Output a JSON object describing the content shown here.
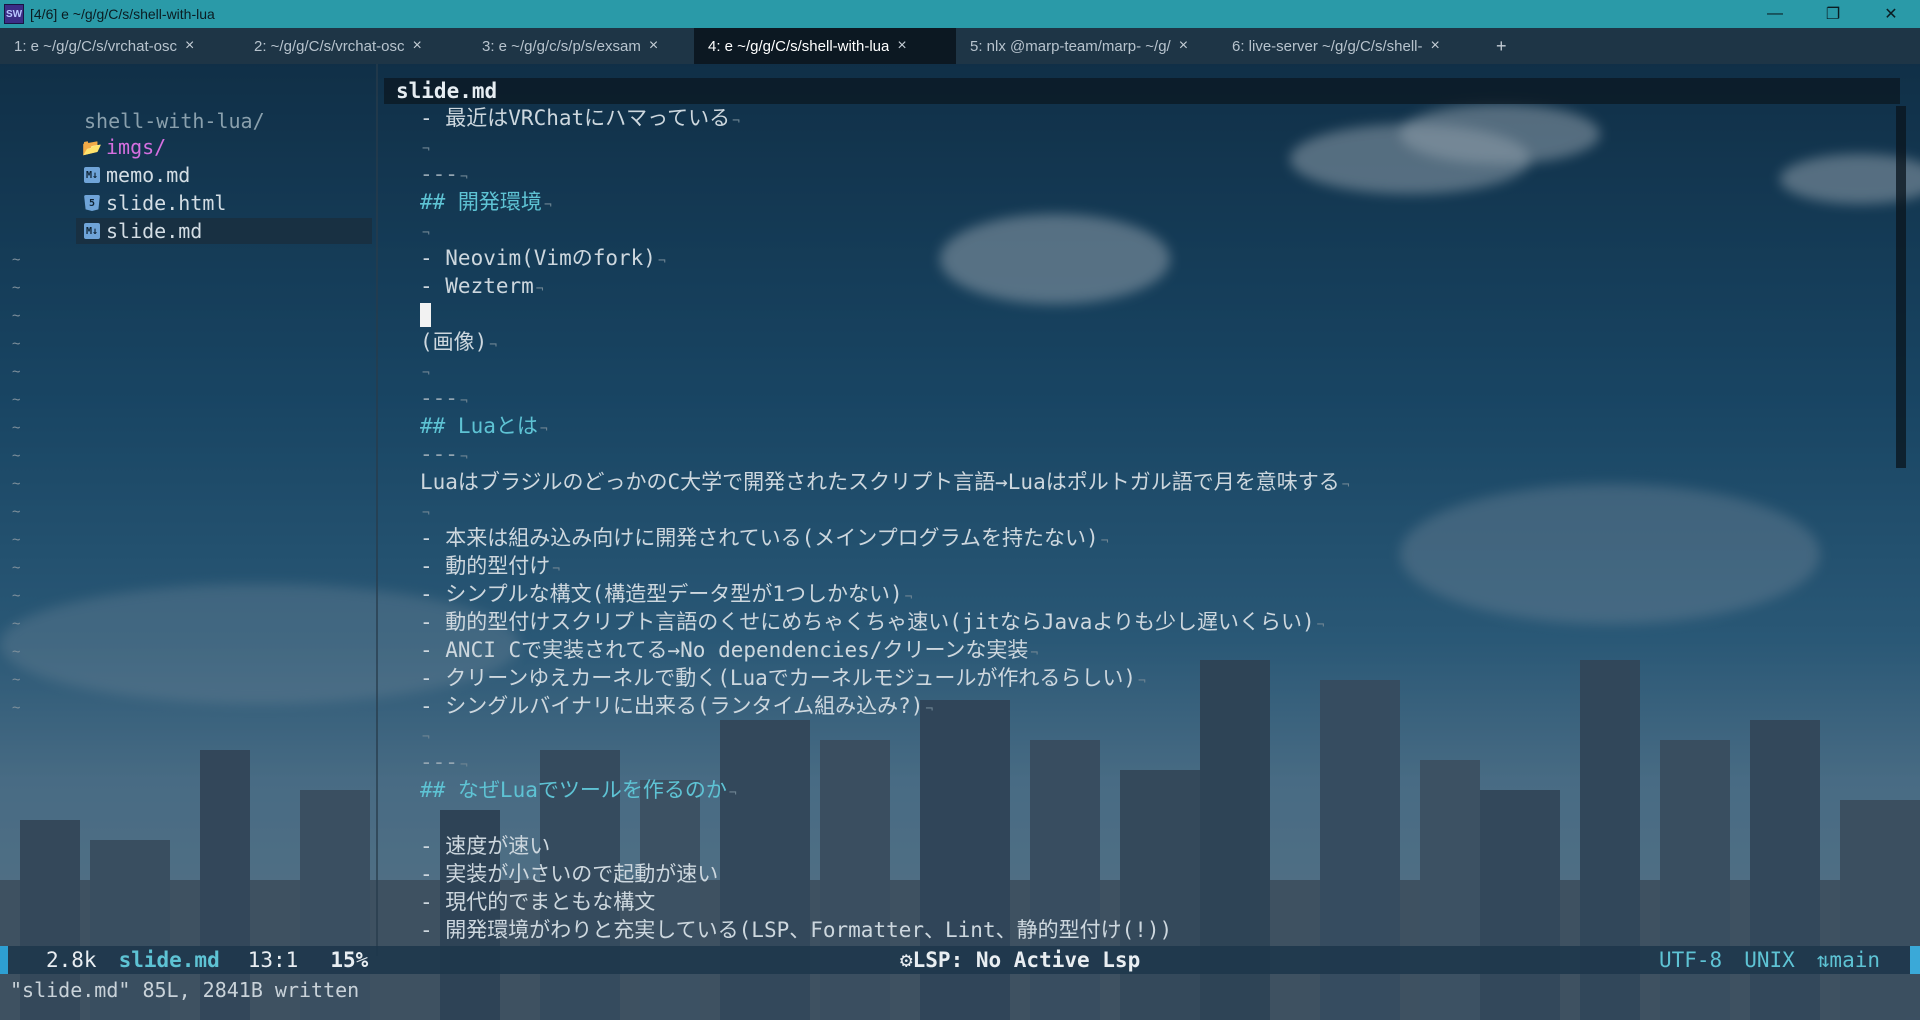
{
  "window": {
    "title": "[4/6] e ~/g/g/C/s/shell-with-lua",
    "app_icon": "SW",
    "minimize": "—",
    "restore": "❐",
    "close": "✕"
  },
  "tabs": [
    {
      "label": "1: e ~/g/g/C/s/vrchat-osc",
      "close": "×"
    },
    {
      "label": "2: ~/g/g/C/s/vrchat-osc",
      "close": "×"
    },
    {
      "label": "3: e ~/g/g/c/s/p/s/exsam",
      "close": "×"
    },
    {
      "label": "4: e ~/g/g/C/s/shell-with-lua",
      "close": "×"
    },
    {
      "label": "5: nlx @marp-team/marp- ~/g/",
      "close": "×"
    },
    {
      "label": "6: live-server ~/g/g/C/s/shell-",
      "close": "×"
    }
  ],
  "tab_add": "+",
  "sidebar": {
    "root": "shell-with-lua/",
    "items": [
      {
        "label": "imgs/",
        "icon": "folder-icon"
      },
      {
        "label": "memo.md",
        "icon": "markdown-icon"
      },
      {
        "label": "slide.html",
        "icon": "html-icon"
      },
      {
        "label": "slide.md",
        "icon": "markdown-icon"
      }
    ],
    "tilde": "~"
  },
  "editor": {
    "filename": "slide.md",
    "nl": "¬",
    "lines": [
      "- 最近はVRChatにハマっている",
      "",
      "---",
      "## 開発環境",
      "",
      "- Neovim(Vimのfork)",
      "- Wezterm",
      "",
      "(画像)",
      "",
      "---",
      "## Luaとは",
      "---",
      "LuaはブラジルのどっかのC大学で開発されたスクリプト言語→Luaはポルトガル語で月を意味する",
      "",
      "- 本来は組み込み向けに開発されている(メインプログラムを持たない)",
      "- 動的型付け",
      "- シンプルな構文(構造型データ型が1つしかない)",
      "- 動的型付けスクリプト言語のくせにめちゃくちゃ速い(jitならJavaよりも少し遅いくらい)",
      "- ANCI Cで実装されてる→No dependencies/クリーンな実装",
      "- クリーンゆえカーネルで動く(Luaでカーネルモジュールが作れるらしい)",
      "- シングルバイナリに出来る(ランタイム組み込み?)",
      "",
      "---",
      "## なぜLuaでツールを作るのか",
      "",
      "- 速度が速い",
      "- 実装が小さいので起動が速い",
      "- 現代的でまともな構文",
      "- 開発環境がわりと充実している(LSP、Formatter、Lint、静的型付け(!))"
    ]
  },
  "status": {
    "size": "2.8k",
    "file": "slide.md",
    "position": "13:1",
    "percent": "15%",
    "lsp": "⚙LSP: No Active Lsp",
    "encoding": "UTF-8",
    "format": "UNIX",
    "branch": "⇅main"
  },
  "cmdline": "\"slide.md\" 85L, 2841B written"
}
